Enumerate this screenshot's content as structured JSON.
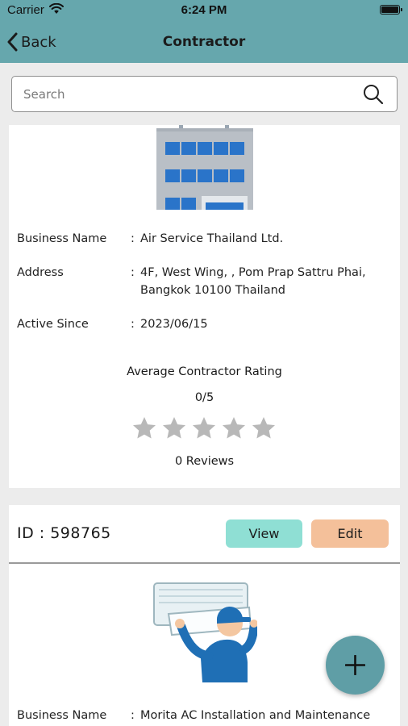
{
  "status_bar": {
    "carrier": "Carrier",
    "time": "6:24 PM"
  },
  "nav": {
    "back_label": "Back",
    "title": "Contractor"
  },
  "search": {
    "placeholder": "Search"
  },
  "contractors": [
    {
      "business_name_label": "Business Name",
      "business_name": "Air Service Thailand Ltd.",
      "address_label": "Address",
      "address_line1": "4F, West Wing, , Pom Prap Sattru Phai,",
      "address_line2": "Bangkok 10100  Thailand",
      "active_since_label": "Active Since",
      "active_since": "2023/06/15",
      "rating_title": "Average Contractor Rating",
      "rating_score": "0/5",
      "rating_value": 0,
      "rating_max": 5,
      "reviews": "0 Reviews"
    },
    {
      "id_label": "ID : 598765",
      "view_label": "View",
      "edit_label": "Edit",
      "business_name_label": "Business Name",
      "business_name": "Morita AC Installation and Maintenance"
    }
  ],
  "colors": {
    "header": "#66a7ad",
    "view_button": "#8fdfd4",
    "edit_button": "#f4c09a",
    "fab": "#5f9ea6",
    "star_empty": "#b8b8b8"
  },
  "icons": {
    "back": "chevron-left-icon",
    "search": "search-icon",
    "fab": "plus-icon",
    "star": "star-icon"
  }
}
